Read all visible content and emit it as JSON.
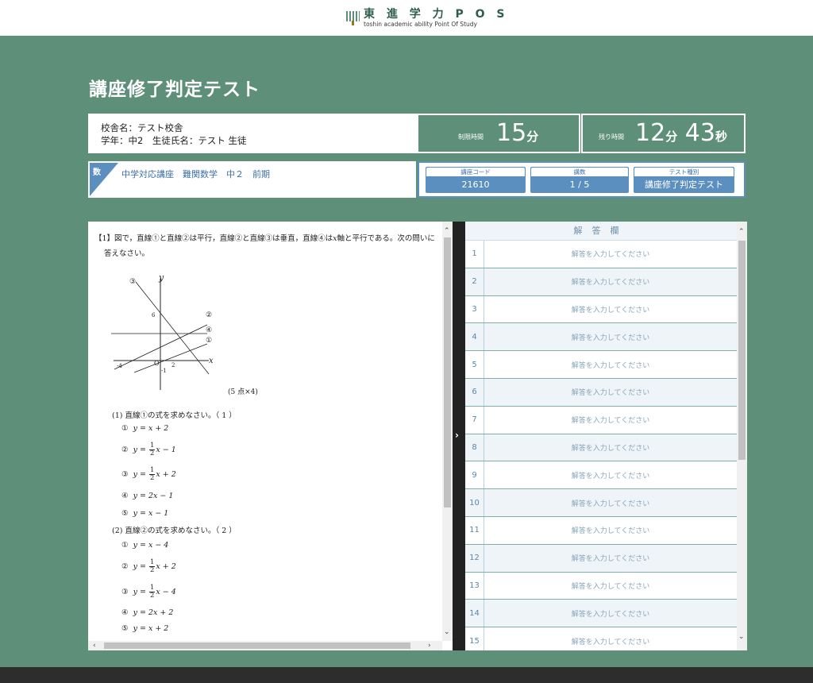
{
  "header": {
    "logo_title": "東 進 学 力 P O S",
    "logo_subtitle": "toshin academic ability Point Of Study",
    "brand_color": "#2f5f4b"
  },
  "page": {
    "title": "講座修了判定テスト",
    "background_color": "#5d8f79"
  },
  "student": {
    "school_line": "校舎名：テスト校舎",
    "grade_line": "学年：中2　生徒氏名：テスト 生徒"
  },
  "timer": {
    "limit_label": "制限時間",
    "limit_value": "15",
    "limit_unit": "分",
    "remaining_label": "残り時間",
    "remaining_min": "12",
    "remaining_min_unit": "分",
    "remaining_sec": "43",
    "remaining_sec_unit": "秒"
  },
  "course": {
    "subject_badge": "数",
    "name": "中学対応講座　難関数学　中２　前期",
    "code_label": "講座コード",
    "code_value": "21610",
    "lesson_label": "講数",
    "lesson_value": "1 / 5",
    "test_type_label": "テスト種別",
    "test_type_value": "講座修了判定テスト",
    "accent_color": "#5b8fbf"
  },
  "question": {
    "intro_line1": "【1】図で，直線①と直線②は平行，直線②と直線③は垂直，直線④は",
    "intro_x": "x",
    "intro_line1_end": "軸と平行である。次の問いに",
    "intro_line2": "答えなさい。",
    "graph": {
      "axis_x": "x",
      "axis_y": "y",
      "origin": "O",
      "tick_6": "6",
      "tick_minus4": "-4",
      "tick_minus1": "-1",
      "tick_2": "2",
      "line_labels": [
        "③",
        "②",
        "④",
        "①"
      ]
    },
    "points": "(5 点×4)",
    "sub1": {
      "prompt": "(1) 直線①の式を求めなさい。（ 1 ）",
      "options": [
        {
          "num": "①",
          "pre": "y = x + 2"
        },
        {
          "num": "②",
          "pre": "y = ",
          "frac_n": "1",
          "frac_d": "2",
          "post": "x − 1"
        },
        {
          "num": "③",
          "pre": "y = ",
          "frac_n": "1",
          "frac_d": "2",
          "post": "x + 2"
        },
        {
          "num": "④",
          "pre": "y = 2x − 1"
        },
        {
          "num": "⑤",
          "pre": "y = x − 1"
        }
      ]
    },
    "sub2": {
      "prompt": "(2) 直線②の式を求めなさい。（ 2 ）",
      "options": [
        {
          "num": "①",
          "pre": "y = x − 4"
        },
        {
          "num": "②",
          "pre": "y = ",
          "frac_n": "1",
          "frac_d": "2",
          "post": "x + 2"
        },
        {
          "num": "③",
          "pre": "y = ",
          "frac_n": "1",
          "frac_d": "2",
          "post": "x − 4"
        },
        {
          "num": "④",
          "pre": "y = 2x + 2"
        },
        {
          "num": "⑤",
          "pre": "y = x + 2"
        }
      ]
    }
  },
  "answer_panel": {
    "header": "解答欄",
    "rows": [
      {
        "no": "1",
        "placeholder": "解答を入力してください"
      },
      {
        "no": "2",
        "placeholder": "解答を入力してください"
      },
      {
        "no": "3",
        "placeholder": "解答を入力してください"
      },
      {
        "no": "4",
        "placeholder": "解答を入力してください"
      },
      {
        "no": "5",
        "placeholder": "解答を入力してください"
      },
      {
        "no": "6",
        "placeholder": "解答を入力してください"
      },
      {
        "no": "7",
        "placeholder": "解答を入力してください"
      },
      {
        "no": "8",
        "placeholder": "解答を入力してください"
      },
      {
        "no": "9",
        "placeholder": "解答を入力してください"
      },
      {
        "no": "10",
        "placeholder": "解答を入力してください"
      },
      {
        "no": "11",
        "placeholder": "解答を入力してください"
      },
      {
        "no": "12",
        "placeholder": "解答を入力してください"
      },
      {
        "no": "13",
        "placeholder": "解答を入力してください"
      },
      {
        "no": "14",
        "placeholder": "解答を入力してください"
      },
      {
        "no": "15",
        "placeholder": "解答を入力してください"
      }
    ]
  },
  "icons": {
    "divider_toggle": "chevron-right-icon",
    "scroll_up": "chevron-up-icon",
    "scroll_down": "chevron-down-icon",
    "scroll_left": "chevron-left-icon",
    "scroll_right": "chevron-right-icon"
  }
}
